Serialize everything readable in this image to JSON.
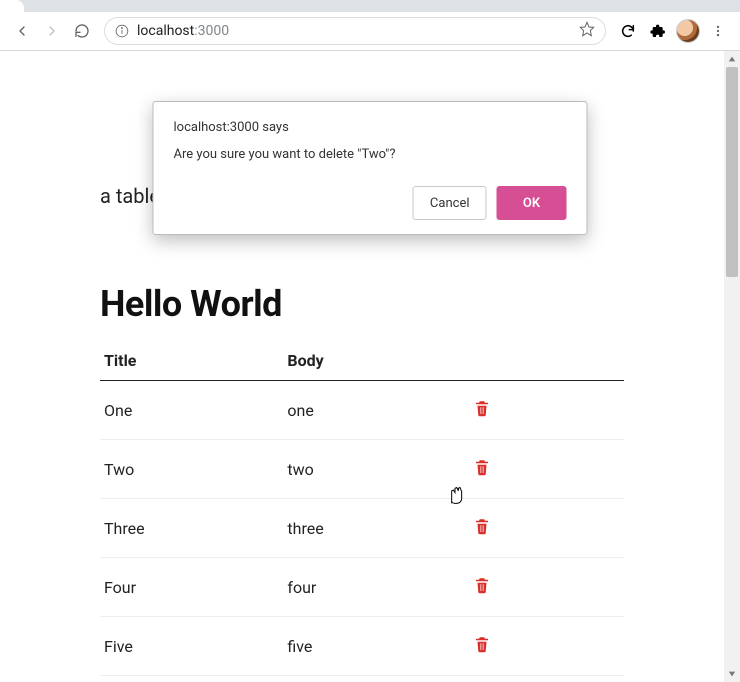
{
  "browser": {
    "url_host": "localhost",
    "url_port": ":3000"
  },
  "dialog": {
    "origin_text": "localhost:3000 says",
    "message": "Are you sure you want to delete \"Two\"?",
    "cancel_label": "Cancel",
    "ok_label": "OK"
  },
  "page": {
    "intro_fragment": "a table row with a delete button and fade effect.",
    "heading": "Hello World",
    "table": {
      "columns": {
        "title": "Title",
        "body": "Body"
      },
      "rows": [
        {
          "title": "One",
          "body": "one"
        },
        {
          "title": "Two",
          "body": "two"
        },
        {
          "title": "Three",
          "body": "three"
        },
        {
          "title": "Four",
          "body": "four"
        },
        {
          "title": "Five",
          "body": "five"
        }
      ]
    }
  },
  "colors": {
    "accent_pink": "#d64e93",
    "trash_red": "#d9302c"
  }
}
